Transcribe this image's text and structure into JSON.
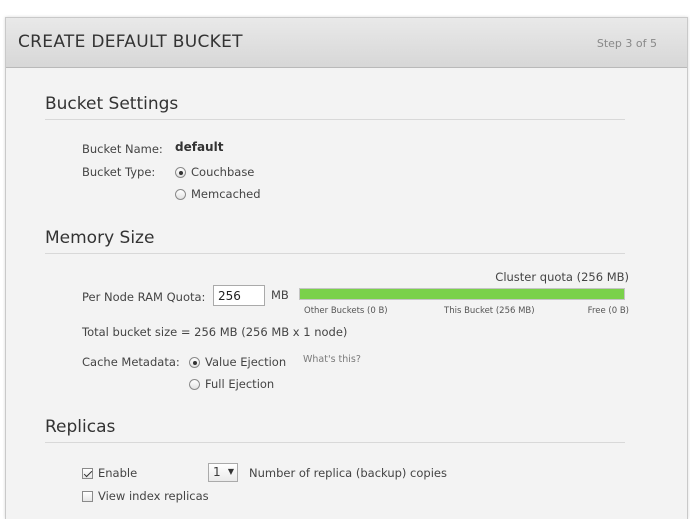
{
  "header": {
    "title": "CREATE DEFAULT BUCKET",
    "step": "Step 3 of 5"
  },
  "bucket_settings": {
    "title": "Bucket Settings",
    "name_label": "Bucket Name:",
    "name_value": "default",
    "type_label": "Bucket Type:",
    "type_options": [
      {
        "label": "Couchbase",
        "selected": true
      },
      {
        "label": "Memcached",
        "selected": false
      }
    ]
  },
  "memory_size": {
    "title": "Memory Size",
    "cluster_quota": "Cluster quota (256 MB)",
    "ram_quota_label": "Per Node RAM Quota:",
    "ram_quota_value": "256",
    "ram_quota_unit": "MB",
    "bar": {
      "this_bucket_fraction": 1.0,
      "fill_color": "#7ad14a",
      "other_buckets": "Other Buckets (0 B)",
      "this_bucket": "This Bucket (256 MB)",
      "free": "Free (0 B)"
    },
    "total_size": "Total bucket size = 256 MB (256 MB x 1 node)",
    "cache_label": "Cache Metadata:",
    "cache_options": [
      {
        "label": "Value Ejection",
        "selected": true
      },
      {
        "label": "Full Ejection",
        "selected": false
      }
    ],
    "whats_this": "What's this?"
  },
  "replicas": {
    "title": "Replicas",
    "enable_label": "Enable",
    "enable_checked": true,
    "count_value": "1",
    "count_label": "Number of replica (backup) copies",
    "view_index_label": "View index replicas",
    "view_index_checked": false
  }
}
